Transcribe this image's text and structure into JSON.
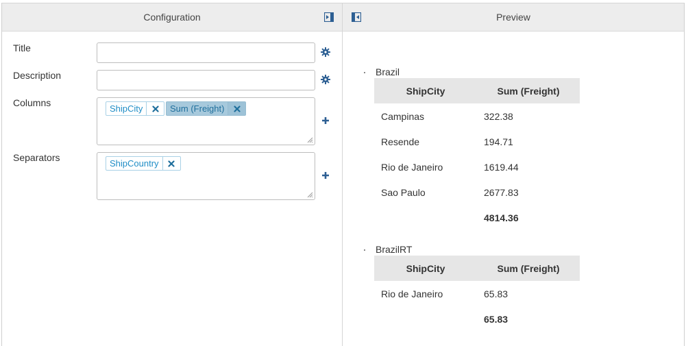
{
  "configuration": {
    "header": "Configuration",
    "fields": {
      "title_label": "Title",
      "title_value": "",
      "description_label": "Description",
      "description_value": "",
      "columns_label": "Columns",
      "separators_label": "Separators"
    },
    "columns_tags": [
      {
        "label": "ShipCity",
        "selected": false
      },
      {
        "label": "Sum (Freight)",
        "selected": true
      }
    ],
    "separators_tags": [
      {
        "label": "ShipCountry",
        "selected": false
      }
    ]
  },
  "preview": {
    "header": "Preview",
    "groups": [
      {
        "title": "Brazil",
        "headers": [
          "ShipCity",
          "Sum (Freight)"
        ],
        "rows": [
          [
            "Campinas",
            "322.38"
          ],
          [
            "Resende",
            "194.71"
          ],
          [
            "Rio de Janeiro",
            "1619.44"
          ],
          [
            "Sao Paulo",
            "2677.83"
          ]
        ],
        "total": "4814.36"
      },
      {
        "title": "BrazilRT",
        "headers": [
          "ShipCity",
          "Sum (Freight)"
        ],
        "rows": [
          [
            "Rio de Janeiro",
            "65.83"
          ]
        ],
        "total": "65.83"
      }
    ]
  },
  "icons": {
    "gear": "gear-icon",
    "plus": "plus-icon",
    "remove": "close-icon",
    "collapse_left": "collapse-left-icon",
    "collapse_right": "collapse-right-icon"
  },
  "colors": {
    "accent_blue": "#2d5f93",
    "tag_text": "#1f8dc6",
    "tag_selected_bg": "#a7c9dc",
    "header_bg": "#ededed",
    "table_header_bg": "#e6e6e6"
  }
}
